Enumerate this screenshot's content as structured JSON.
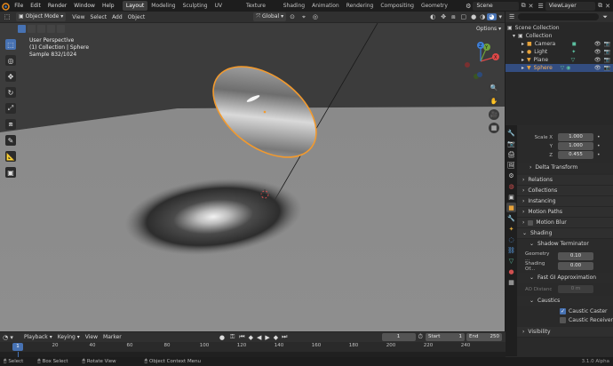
{
  "menubar": {
    "items": [
      "File",
      "Edit",
      "Render",
      "Window",
      "Help"
    ]
  },
  "workspaces": [
    "Layout",
    "Modeling",
    "Sculpting",
    "UV Editing",
    "Texture Paint",
    "Shading",
    "Animation",
    "Rendering",
    "Compositing",
    "Geometry Nodes"
  ],
  "active_workspace": "Layout",
  "scene": {
    "name": "Scene",
    "view_layer": "ViewLayer"
  },
  "viewport_header": {
    "mode": "Object Mode",
    "menus": [
      "View",
      "Select",
      "Add",
      "Object"
    ],
    "transform": "Global",
    "options": "Options"
  },
  "viewport_info": {
    "line1": "User Perspective",
    "line2": "(1) Collection | Sphere",
    "line3": "Sample 832/1024"
  },
  "gizmo": {
    "x": "X",
    "y": "Y",
    "z": "Z"
  },
  "outliner": {
    "root": "Scene Collection",
    "collection": "Collection",
    "items": [
      {
        "name": "Camera",
        "icon": "camera-icon",
        "color": "#e8a33a"
      },
      {
        "name": "Light",
        "icon": "light-icon",
        "color": "#e8a33a"
      },
      {
        "name": "Plane",
        "icon": "mesh-icon",
        "color": "#e8a33a"
      },
      {
        "name": "Sphere",
        "icon": "mesh-icon",
        "color": "#e8a33a"
      }
    ],
    "selected": "Sphere"
  },
  "properties": {
    "scale": {
      "label": "Scale X",
      "x_label": "Scale X",
      "y_label": "Y",
      "z_label": "Z",
      "x": "1.000",
      "y": "1.000",
      "z": "0.455"
    },
    "sections": {
      "delta": "Delta Transform",
      "relations": "Relations",
      "collections": "Collections",
      "instancing": "Instancing",
      "motion_paths": "Motion Paths",
      "motion_blur": "Motion Blur",
      "shading": "Shading",
      "shadow_terminator": "Shadow Terminator",
      "fast_gi": "Fast GI Approximation",
      "caustics": "Caustics",
      "visibility": "Visibility"
    },
    "fields": {
      "geometry_label": "Geometry ...",
      "geometry_value": "0.10",
      "shading_label": "Shading Of...",
      "shading_value": "0.00",
      "ao_label": "AO Distanc",
      "ao_value": "0 m"
    },
    "checks": {
      "caustic_caster": "Caustic Caster",
      "caustic_receiver": "Caustic Receiver",
      "caster_on": true,
      "receiver_on": false
    }
  },
  "timeline": {
    "menus": [
      "Playback",
      "Keying",
      "View",
      "Marker"
    ],
    "current_frame": "1",
    "start_label": "Start",
    "start": "1",
    "end_label": "End",
    "end": "250",
    "ruler_current": "1",
    "ticks": [
      "20",
      "40",
      "60",
      "80",
      "100",
      "120",
      "140",
      "160",
      "180",
      "200",
      "220",
      "240"
    ]
  },
  "statusbar": {
    "select": "Select",
    "box_select": "Box Select",
    "rotate": "Rotate View",
    "context": "Object Context Menu",
    "version": "3.1.0 Alpha"
  },
  "colors": {
    "accent": "#4772b3",
    "selection_orange": "#f29a2e",
    "active_workspace_bg": "#3d3d3d"
  }
}
